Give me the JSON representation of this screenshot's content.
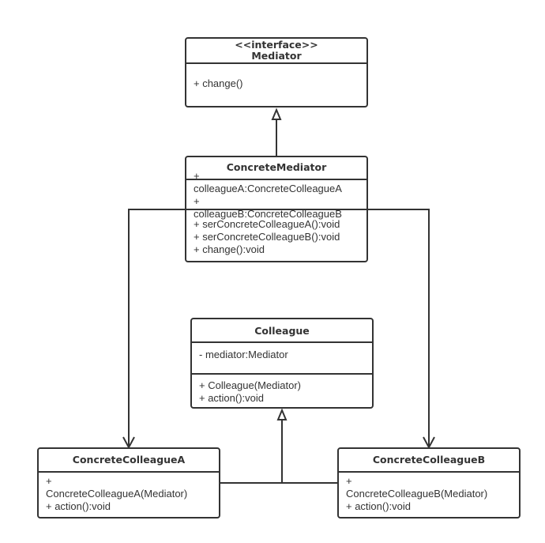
{
  "classes": {
    "mediator": {
      "stereotype": "<<interface>>",
      "name": "Mediator",
      "methods": [
        "+ change()"
      ]
    },
    "concrete_mediator": {
      "name": "ConcreteMediator",
      "attributes": [
        "+",
        "colleagueA:ConcreteColleagueA",
        "+",
        "colleagueB:ConcreteColleagueB"
      ],
      "methods": [
        "+ serConcreteColleagueA():void",
        "+ serConcreteColleagueB():void",
        "+ change():void"
      ]
    },
    "colleague": {
      "name": "Colleague",
      "attributes": [
        "- mediator:Mediator"
      ],
      "methods": [
        "+ Colleague(Mediator)",
        "+ action():void"
      ]
    },
    "concrete_colleague_a": {
      "name": "ConcreteColleagueA",
      "methods": [
        "+",
        "ConcreteColleagueA(Mediator)",
        "+ action():void"
      ]
    },
    "concrete_colleague_b": {
      "name": "ConcreteColleagueB",
      "methods": [
        "+",
        "ConcreteColleagueB(Mediator)",
        "+ action():void"
      ]
    }
  },
  "relations": [
    {
      "from": "ConcreteMediator",
      "to": "Mediator",
      "type": "realization"
    },
    {
      "from": "ConcreteMediator",
      "to": "ConcreteColleagueA",
      "type": "association"
    },
    {
      "from": "ConcreteMediator",
      "to": "ConcreteColleagueB",
      "type": "association"
    },
    {
      "from": "ConcreteColleagueA",
      "to": "Colleague",
      "type": "generalization"
    },
    {
      "from": "ConcreteColleagueB",
      "to": "Colleague",
      "type": "generalization"
    }
  ]
}
